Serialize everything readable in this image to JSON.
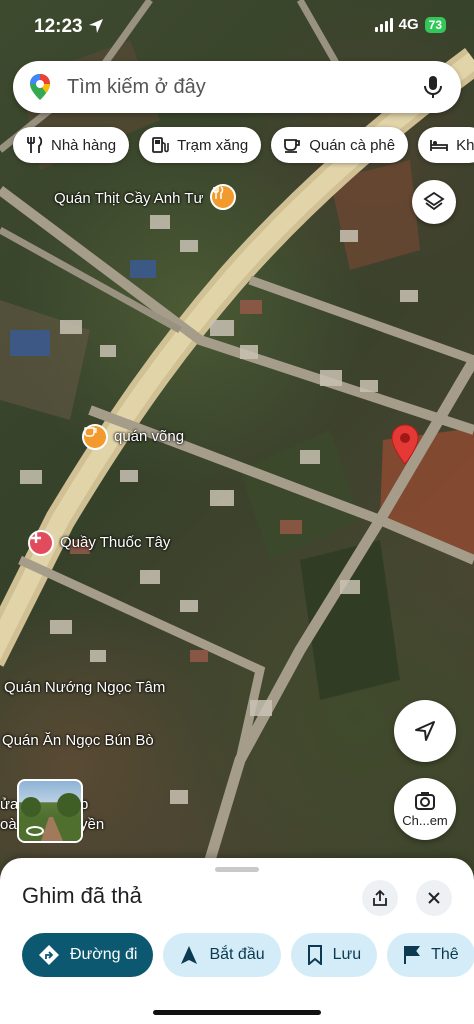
{
  "status": {
    "time": "12:23",
    "network": "4G",
    "battery": "73"
  },
  "search": {
    "placeholder": "Tìm kiếm ở đây"
  },
  "chips": [
    {
      "label": "Nhà hàng",
      "icon": "fork-knife-icon"
    },
    {
      "label": "Trạm xăng",
      "icon": "gas-station-icon"
    },
    {
      "label": "Quán cà phê",
      "icon": "coffee-cup-icon"
    },
    {
      "label": "Kh",
      "icon": "bed-icon"
    }
  ],
  "map": {
    "places": [
      {
        "name": "Quán Thịt Cầy Anh Tư"
      },
      {
        "name": "quán võng"
      },
      {
        "name": "Quầy Thuốc Tây"
      },
      {
        "name": "Quán Nướng Ngọc Tâm"
      },
      {
        "name": "Quán Ăn Ngọc Bún Bò"
      },
      {
        "name_line1": "ửa",
        "name_line2": "oà"
      },
      {
        "name_line1": "p",
        "name_line2": "yền"
      }
    ],
    "camera_label": "Ch...em"
  },
  "sheet": {
    "title": "Ghim đã thả",
    "actions": [
      {
        "label": "Đường đi",
        "icon": "directions-icon"
      },
      {
        "label": "Bắt đầu",
        "icon": "navigation-arrow-icon"
      },
      {
        "label": "Lưu",
        "icon": "bookmark-icon"
      },
      {
        "label": "Thê",
        "icon": "flag-icon"
      }
    ]
  },
  "colors": {
    "accent": "#0b5870",
    "chip_bg": "#d4ecf7",
    "pin": "#e53935",
    "battery": "#33c759"
  }
}
